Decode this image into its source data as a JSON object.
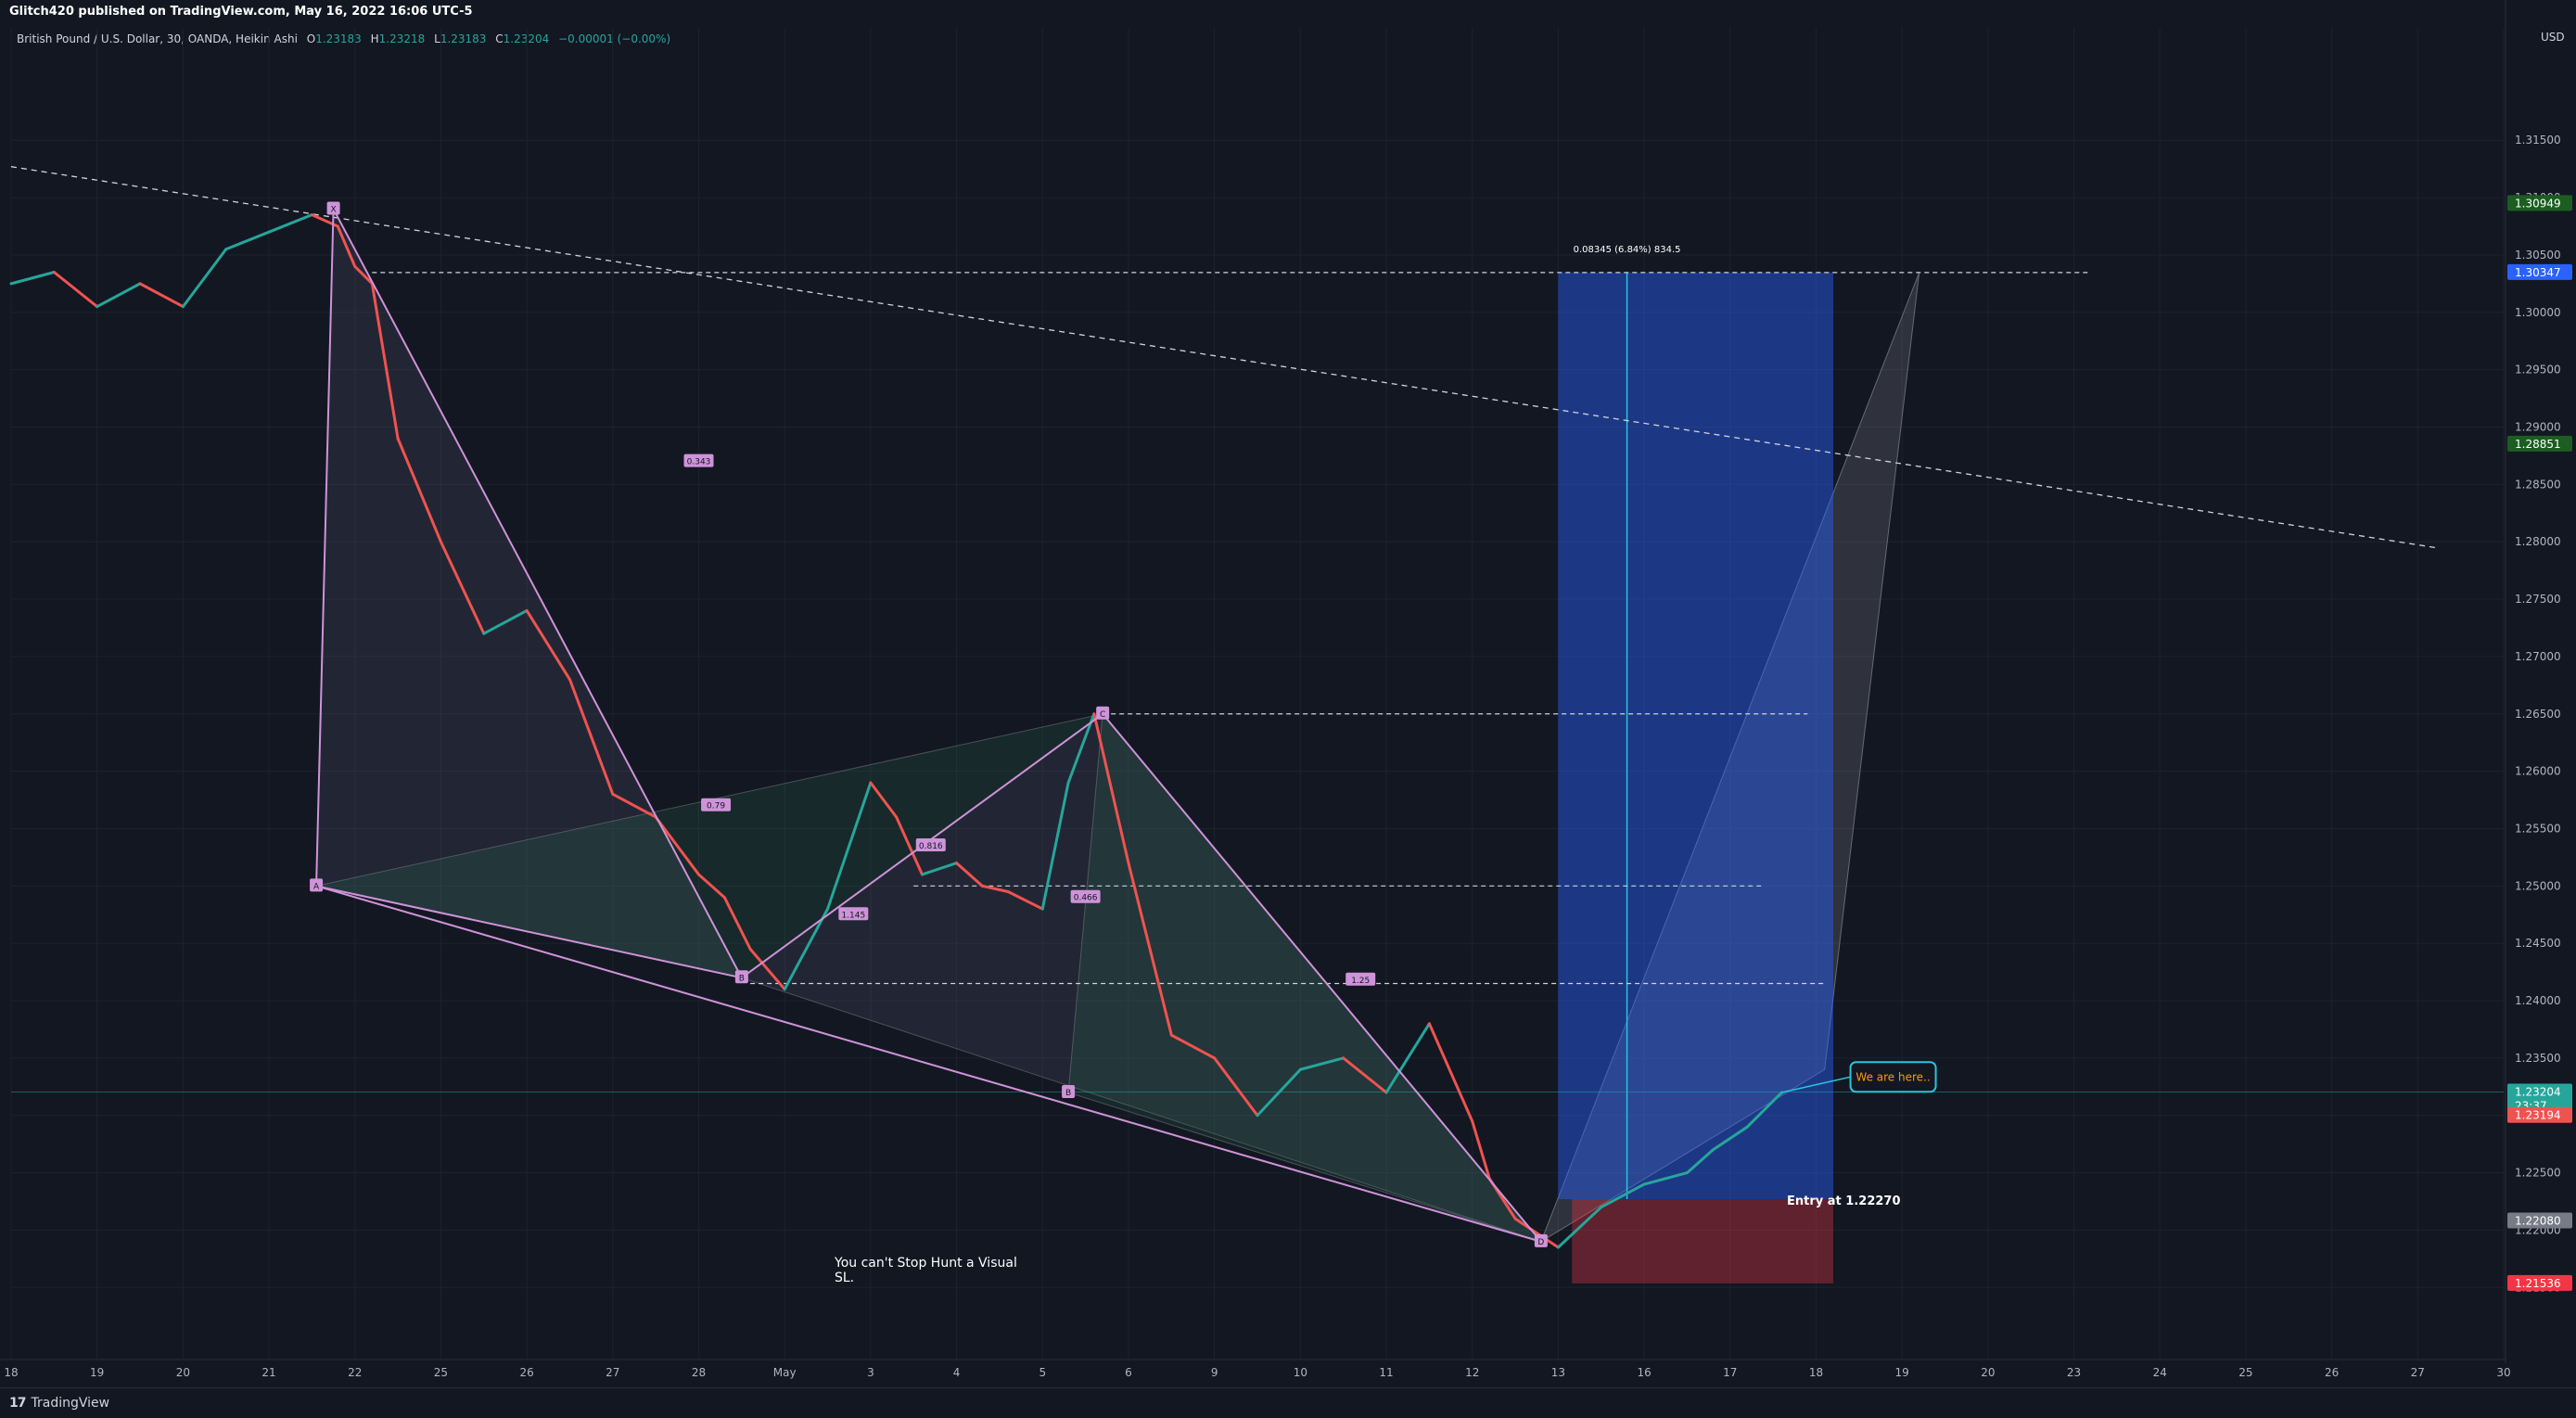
{
  "header": {
    "publish_line": "Glitch420 published on TradingView.com, May 16, 2022 16:06 UTC-5"
  },
  "symbol": {
    "description": "British Pound / U.S. Dollar, 30, OANDA, Heikin Ashi",
    "open_label": "O",
    "open": "1.23183",
    "high_label": "H",
    "high": "1.23218",
    "low_label": "L",
    "low": "1.23183",
    "close_label": "C",
    "close": "1.23204",
    "change": "−0.00001 (−0.00%)"
  },
  "footer": {
    "brand": "TradingView",
    "logo_text": "17"
  },
  "colors": {
    "background": "#131722",
    "bull": "#26a69a",
    "bear": "#ef5350",
    "pattern_line": "#ce93d8",
    "target_zone": "#2962ff",
    "stop_zone": "#f23645",
    "grid": "#1e222d"
  },
  "chart_data": {
    "type": "line",
    "title": "",
    "instrument": "British Pound / U.S. Dollar",
    "timeframe": "30",
    "chart_style": "Heikin Ashi",
    "currency_unit": "USD",
    "ylim": [
      1.2088,
      1.3248
    ],
    "x_ticks": [
      "18",
      "19",
      "20",
      "21",
      "22",
      "25",
      "26",
      "27",
      "28",
      "May",
      "3",
      "4",
      "5",
      "6",
      "9",
      "10",
      "11",
      "12",
      "13",
      "16",
      "17",
      "18",
      "19",
      "20",
      "23",
      "24",
      "25",
      "26",
      "27",
      "30"
    ],
    "y_ticks": [
      1.315,
      1.31,
      1.305,
      1.3,
      1.295,
      1.29,
      1.285,
      1.28,
      1.275,
      1.27,
      1.265,
      1.26,
      1.255,
      1.25,
      1.245,
      1.24,
      1.235,
      1.23,
      1.225,
      1.22,
      1.215
    ],
    "y_tick_labels": [
      "1.31500",
      "1.31000",
      "1.30500",
      "1.30000",
      "1.29500",
      "1.29000",
      "1.28500",
      "1.28000",
      "1.27500",
      "1.27000",
      "1.26500",
      "1.26000",
      "1.25500",
      "1.25000",
      "1.24500",
      "1.24000",
      "1.23500",
      "1.23000",
      "1.22500",
      "1.22000",
      "1.21500"
    ],
    "price_series": {
      "name": "GBPUSD",
      "x": [
        0,
        0.5,
        1,
        1.5,
        2,
        2.5,
        3,
        3.5,
        3.8,
        4,
        4.2,
        4.5,
        5,
        5.5,
        6,
        6.5,
        7,
        7.5,
        8,
        8.3,
        8.6,
        9,
        9.5,
        10,
        10.3,
        10.6,
        11,
        11.3,
        11.6,
        12,
        12.3,
        12.6,
        13,
        13.5,
        14,
        14.5,
        15,
        15.5,
        16,
        16.5,
        17,
        17.2,
        17.5,
        18,
        18.5,
        19,
        19.5,
        19.8,
        20.2,
        20.6
      ],
      "y": [
        1.3025,
        1.3035,
        1.3005,
        1.3025,
        1.3005,
        1.3055,
        1.307,
        1.3085,
        1.3075,
        1.304,
        1.3025,
        1.289,
        1.28,
        1.272,
        1.274,
        1.268,
        1.258,
        1.256,
        1.251,
        1.249,
        1.2445,
        1.241,
        1.248,
        1.259,
        1.256,
        1.251,
        1.252,
        1.25,
        1.2495,
        1.248,
        1.259,
        1.265,
        1.252,
        1.237,
        1.235,
        1.23,
        1.234,
        1.235,
        1.232,
        1.238,
        1.2295,
        1.2245,
        1.221,
        1.2185,
        1.222,
        1.224,
        1.225,
        1.227,
        1.229,
        1.232
      ]
    },
    "pattern_points": [
      {
        "label": "X",
        "x": 3.75,
        "y": 1.309
      },
      {
        "label": "A",
        "x": 3.55,
        "y": 1.25
      },
      {
        "label": "B",
        "x": 8.5,
        "y": 1.242
      },
      {
        "label": "C",
        "x": 12.7,
        "y": 1.265
      },
      {
        "label": "D",
        "x": 17.8,
        "y": 1.219
      },
      {
        "label": "B",
        "x": 12.3,
        "y": 1.232
      }
    ],
    "horizontal_levels": [
      {
        "value": 1.30347,
        "from_x": 4.2,
        "to_x": 24.2
      },
      {
        "value": 1.265,
        "from_x": 12.7,
        "to_x": 20.9
      },
      {
        "value": 1.25,
        "from_x": 10.5,
        "to_x": 20.4
      },
      {
        "value": 1.2415,
        "from_x": 8.6,
        "to_x": 21.1
      }
    ],
    "trendlines": [
      {
        "from": [
          0,
          1.3127
        ],
        "to": [
          28.2,
          1.2795
        ]
      }
    ],
    "ratio_labels": [
      {
        "text": "0.343",
        "x": 8.0,
        "y": 1.287
      },
      {
        "text": "0.816",
        "x": 10.7,
        "y": 1.2535
      },
      {
        "text": "0.79",
        "x": 8.2,
        "y": 1.257
      },
      {
        "text": "1.145",
        "x": 9.8,
        "y": 1.2475
      },
      {
        "text": "0.466",
        "x": 12.5,
        "y": 1.249
      },
      {
        "text": "1.25",
        "x": 15.7,
        "y": 1.2418
      }
    ],
    "position": {
      "type": "long",
      "entry": 1.2227,
      "target": 1.30347,
      "stop": 1.21536,
      "x_start": 18.0,
      "x_end": 21.2,
      "target_label": "0.08345 (6.84%) 834.5",
      "entry_label": "Entry at 1.22270"
    },
    "callout": {
      "text": "We are here..",
      "x": 21.4,
      "y": 1.234
    },
    "annotation": {
      "line1": "You can't Stop Hunt a Visual",
      "line2": "SL."
    },
    "price_axis_markers": [
      {
        "text": "1.30949",
        "value": 1.30949,
        "color": "#1b5e20"
      },
      {
        "text": "1.30347",
        "value": 1.30347,
        "color": "#2962ff"
      },
      {
        "text": "1.28851",
        "value": 1.28851,
        "color": "#1b5e20"
      },
      {
        "text": "1.23204",
        "value": 1.23204,
        "color": "#26a69a",
        "sub": "23:37"
      },
      {
        "text": "1.23194",
        "value": 1.23,
        "color": "#ef5350"
      },
      {
        "text": "1.22080",
        "value": 1.2208,
        "color": "#787b86"
      },
      {
        "text": "1.21536",
        "value": 1.21536,
        "color": "#f23645"
      }
    ]
  }
}
